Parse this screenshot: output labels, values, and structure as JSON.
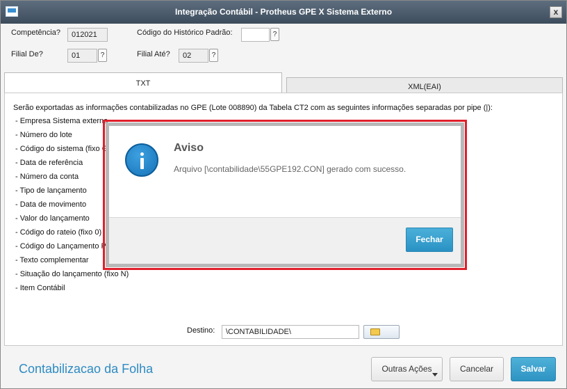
{
  "window": {
    "title": "Integração Contábil - Protheus GPE X Sistema Externo",
    "close_label": "x"
  },
  "form": {
    "competencia_label": "Competência?",
    "competencia_value": "012021",
    "historico_label": "Código do Histórico Padrão:",
    "historico_value": "",
    "filial_de_label": "Filial De?",
    "filial_de_value": "01",
    "filial_ate_label": "Filial Até?",
    "filial_ate_value": "02",
    "help_label": "?"
  },
  "tabs": [
    {
      "label": "TXT",
      "active": true
    },
    {
      "label": "XML(EAI)",
      "active": false
    }
  ],
  "content": {
    "intro": "Serão exportadas as informações contabilizadas no GPE (Lote 008890) da Tabela CT2 com as seguintes informações separadas por pipe (|):",
    "items": [
      "- Empresa Sistema externo",
      "- Número do lote",
      "- Código do sistema (fixo GPE)",
      "- Data de referência",
      "- Número da conta",
      "- Tipo de lançamento",
      "- Data de movimento",
      "- Valor do lançamento",
      "- Código do rateio (fixo 0)",
      "- Código do Lançamento Padrão",
      "- Texto complementar",
      "- Situação do lançamento (fixo N)",
      "- Item Contábil"
    ],
    "destino_label": "Destino:",
    "destino_value": "\\CONTABILIDADE\\"
  },
  "footer": {
    "title": "Contabilizacao da Folha",
    "outras_label": "Outras Ações",
    "cancelar_label": "Cancelar",
    "salvar_label": "Salvar"
  },
  "dialog": {
    "title": "Aviso",
    "message": "Arquivo [\\contabilidade\\55GPE192.CON] gerado com sucesso.",
    "button_label": "Fechar",
    "icon": "info-icon"
  },
  "colors": {
    "accent": "#2d93c2",
    "titlebar": "#4a5a6a",
    "highlight": "#e01f2b"
  }
}
